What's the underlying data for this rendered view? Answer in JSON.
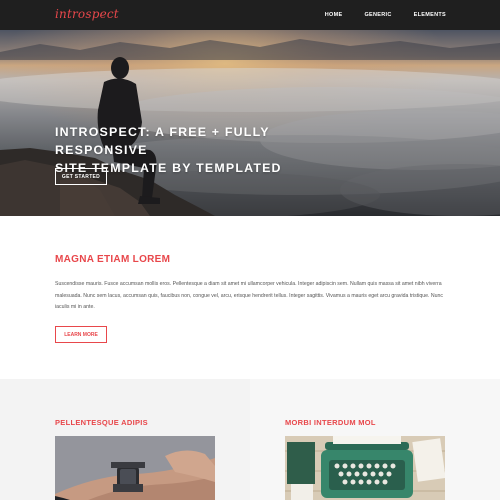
{
  "header": {
    "logo": "introspect",
    "nav": [
      "HOME",
      "GENERIC",
      "ELEMENTS"
    ]
  },
  "hero": {
    "title_line1": "INTROSPECT: A FREE + FULLY RESPONSIVE",
    "title_line2": "SITE TEMPLATE BY TEMPLATED",
    "button": "GET STARTED"
  },
  "main": {
    "heading": "MAGNA ETIAM LOREM",
    "body": "Suscendisse mauris. Fusce accumsan mollis eros. Pellentesque a diam sit amet mi ullamcorper vehicula. Integer adipiscin sem. Nullam quis massa sit amet nibh viverra malesuada. Nunc sem lacus, accumsan quis, faucibus non, congue vel, arcu, erisque hendrerit tellus. Integer sagittis. Vivamus a mauris eget arcu gravida tristique. Nunc iaculis mi in ante.",
    "button": "LEARN MORE"
  },
  "columns": [
    {
      "heading": "PELLENTESQUE ADIPIS",
      "image": "hand-smartwatch-photo"
    },
    {
      "heading": "MORBI INTERDUM MOL",
      "image": "typewriter-desk-photo"
    }
  ],
  "colors": {
    "accent": "#e8474b",
    "header_bg": "#1f1f1f",
    "text": "#555555",
    "left_band": "#f3f3f3",
    "right_band": "#f7f7f7"
  }
}
